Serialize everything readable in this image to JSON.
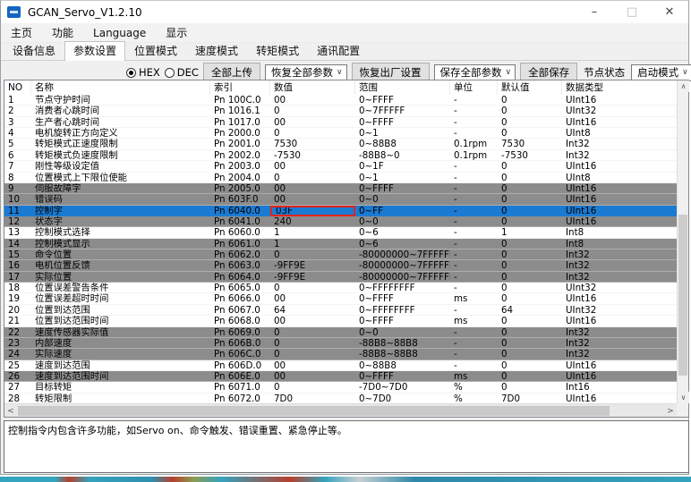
{
  "window": {
    "title": "GCAN_Servo_V1.2.10",
    "minimize": "–",
    "maximize": "□",
    "close": "✕"
  },
  "menubar": {
    "items": [
      "主页",
      "功能",
      "Language",
      "显示"
    ]
  },
  "tabs": {
    "items": [
      "设备信息",
      "参数设置",
      "位置模式",
      "速度模式",
      "转矩模式",
      "通讯配置"
    ],
    "active": "参数设置"
  },
  "toolbar": {
    "radio_hex": "HEX",
    "radio_dec": "DEC",
    "radio_selected": "HEX",
    "upload_all": "全部上传",
    "restore_all_params": "恢复全部参数",
    "factory_reset": "恢复出厂设置",
    "save_all_params": "保存全部参数",
    "save_all": "全部保存",
    "node_status_label": "节点状态",
    "startup_mode": "启动模式",
    "combo_arrow": "∨"
  },
  "table": {
    "columns": [
      "NO",
      "名称",
      "索引",
      "数值",
      "范围",
      "单位",
      "默认值",
      "数据类型"
    ],
    "rows": [
      {
        "cells": [
          "1",
          "节点守护时间",
          "Pn 100C.0",
          "00",
          "0~FFFF",
          "-",
          "0",
          "UInt16"
        ],
        "state": "normal"
      },
      {
        "cells": [
          "2",
          "消费者心跳时间",
          "Pn 1016.1",
          "0",
          "0~7FFFFF",
          "-",
          "0",
          "UInt32"
        ],
        "state": "normal"
      },
      {
        "cells": [
          "3",
          "生产者心跳时间",
          "Pn 1017.0",
          "00",
          "0~FFFF",
          "-",
          "0",
          "UInt16"
        ],
        "state": "normal"
      },
      {
        "cells": [
          "4",
          "电机旋转正方向定义",
          "Pn 2000.0",
          "0",
          "0~1",
          "-",
          "0",
          "UInt8"
        ],
        "state": "normal"
      },
      {
        "cells": [
          "5",
          "转矩模式正速度限制",
          "Pn 2001.0",
          "7530",
          "0~88B8",
          "0.1rpm",
          "7530",
          "Int32"
        ],
        "state": "normal"
      },
      {
        "cells": [
          "6",
          "转矩模式负速度限制",
          "Pn 2002.0",
          "-7530",
          "-88B8~0",
          "0.1rpm",
          "-7530",
          "Int32"
        ],
        "state": "normal"
      },
      {
        "cells": [
          "7",
          "刚性等级设定值",
          "Pn 2003.0",
          "00",
          "0~1F",
          "-",
          "0",
          "UInt16"
        ],
        "state": "normal"
      },
      {
        "cells": [
          "8",
          "位置模式上下限位使能",
          "Pn 2004.0",
          "0",
          "0~1",
          "-",
          "0",
          "UInt8"
        ],
        "state": "normal"
      },
      {
        "cells": [
          "9",
          "伺服故障字",
          "Pn 2005.0",
          "00",
          "0~FFFF",
          "-",
          "0",
          "UInt16"
        ],
        "state": "gray"
      },
      {
        "cells": [
          "10",
          "错误码",
          "Pn 603F.0",
          "00",
          "0~0",
          "-",
          "0",
          "UInt16"
        ],
        "state": "gray"
      },
      {
        "cells": [
          "11",
          "控制字",
          "Pn 6040.0",
          "03F",
          "0~FF",
          "-",
          "0",
          "UInt16"
        ],
        "state": "selected",
        "red_box": true
      },
      {
        "cells": [
          "12",
          "状态字",
          "Pn 6041.0",
          "240",
          "0~0",
          "-",
          "0",
          "UInt16"
        ],
        "state": "gray"
      },
      {
        "cells": [
          "13",
          "控制模式选择",
          "Pn 6060.0",
          "1",
          "0~6",
          "-",
          "1",
          "Int8"
        ],
        "state": "normal"
      },
      {
        "cells": [
          "14",
          "控制模式显示",
          "Pn 6061.0",
          "1",
          "0~6",
          "-",
          "0",
          "Int8"
        ],
        "state": "gray"
      },
      {
        "cells": [
          "15",
          "命令位置",
          "Pn 6062.0",
          "0",
          "-80000000~7FFFFFFF",
          "-",
          "0",
          "Int32"
        ],
        "state": "gray"
      },
      {
        "cells": [
          "16",
          "电机位置反馈",
          "Pn 6063.0",
          "-9FF9E",
          "-80000000~7FFFFFFF",
          "-",
          "0",
          "Int32"
        ],
        "state": "gray"
      },
      {
        "cells": [
          "17",
          "实际位置",
          "Pn 6064.0",
          "-9FF9E",
          "-80000000~7FFFFFFF",
          "-",
          "0",
          "Int32"
        ],
        "state": "gray"
      },
      {
        "cells": [
          "18",
          "位置误差警告条件",
          "Pn 6065.0",
          "0",
          "0~FFFFFFFF",
          "-",
          "0",
          "UInt32"
        ],
        "state": "normal"
      },
      {
        "cells": [
          "19",
          "位置误差超时时间",
          "Pn 6066.0",
          "00",
          "0~FFFF",
          "ms",
          "0",
          "UInt16"
        ],
        "state": "normal"
      },
      {
        "cells": [
          "20",
          "位置到达范围",
          "Pn 6067.0",
          "64",
          "0~FFFFFFFF",
          "-",
          "64",
          "UInt32"
        ],
        "state": "normal"
      },
      {
        "cells": [
          "21",
          "位置到达范围时间",
          "Pn 6068.0",
          "00",
          "0~FFFF",
          "ms",
          "0",
          "UInt16"
        ],
        "state": "normal"
      },
      {
        "cells": [
          "22",
          "速度传感器实际值",
          "Pn 6069.0",
          "0",
          "0~0",
          "-",
          "0",
          "Int32"
        ],
        "state": "gray"
      },
      {
        "cells": [
          "23",
          "内部速度",
          "Pn 606B.0",
          "0",
          "-88B8~88B8",
          "-",
          "0",
          "Int32"
        ],
        "state": "gray"
      },
      {
        "cells": [
          "24",
          "实际速度",
          "Pn 606C.0",
          "0",
          "-88B8~88B8",
          "-",
          "0",
          "Int32"
        ],
        "state": "gray"
      },
      {
        "cells": [
          "25",
          "速度到达范围",
          "Pn 606D.0",
          "00",
          "0~88B8",
          "-",
          "0",
          "UInt16"
        ],
        "state": "normal"
      },
      {
        "cells": [
          "26",
          "速度到达范围时间",
          "Pn 606E.0",
          "00",
          "0~FFFF",
          "ms",
          "0",
          "UInt16"
        ],
        "state": "gray"
      },
      {
        "cells": [
          "27",
          "目标转矩",
          "Pn 6071.0",
          "0",
          "-7D0~7D0",
          "%",
          "0",
          "Int16"
        ],
        "state": "normal"
      },
      {
        "cells": [
          "28",
          "转矩限制",
          "Pn 6072.0",
          "7D0",
          "0~7D0",
          "%",
          "7D0",
          "UInt16"
        ],
        "state": "normal"
      }
    ]
  },
  "scrollbars": {
    "up": "∧",
    "down": "∨",
    "left": "<",
    "right": ">"
  },
  "note": "控制指令内包含许多功能，如Servo on、命令触发、错误重置、紧急停止等。",
  "colors": {
    "selected_row": "#1b7ad2",
    "gray_row": "#8c8c8c",
    "red_box": "#e0251b",
    "accent_icon": "#1565c0"
  }
}
